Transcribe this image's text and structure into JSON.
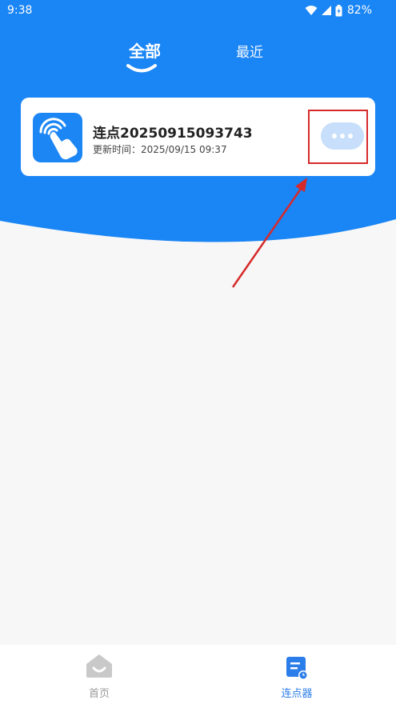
{
  "status_bar": {
    "time": "9:38",
    "battery": "82%"
  },
  "tabs": [
    {
      "label": "全部",
      "active": true
    },
    {
      "label": "最近",
      "active": false
    }
  ],
  "card": {
    "title": "连点20250915093743",
    "updated_label": "更新时间：",
    "updated_time": "2025/09/15 09:37",
    "icon": "tap-gesture-icon",
    "more_icon": "more-dots-icon"
  },
  "bottom_nav": [
    {
      "label": "首页",
      "icon": "home-icon",
      "active": false
    },
    {
      "label": "连点器",
      "icon": "clicker-list-icon",
      "active": true
    }
  ],
  "colors": {
    "primary": "#1a85f5",
    "more_button": "#c7dffb",
    "highlight": "#d62a2a",
    "nav_active": "#2b7de9",
    "nav_inactive": "#9a9a9a"
  }
}
